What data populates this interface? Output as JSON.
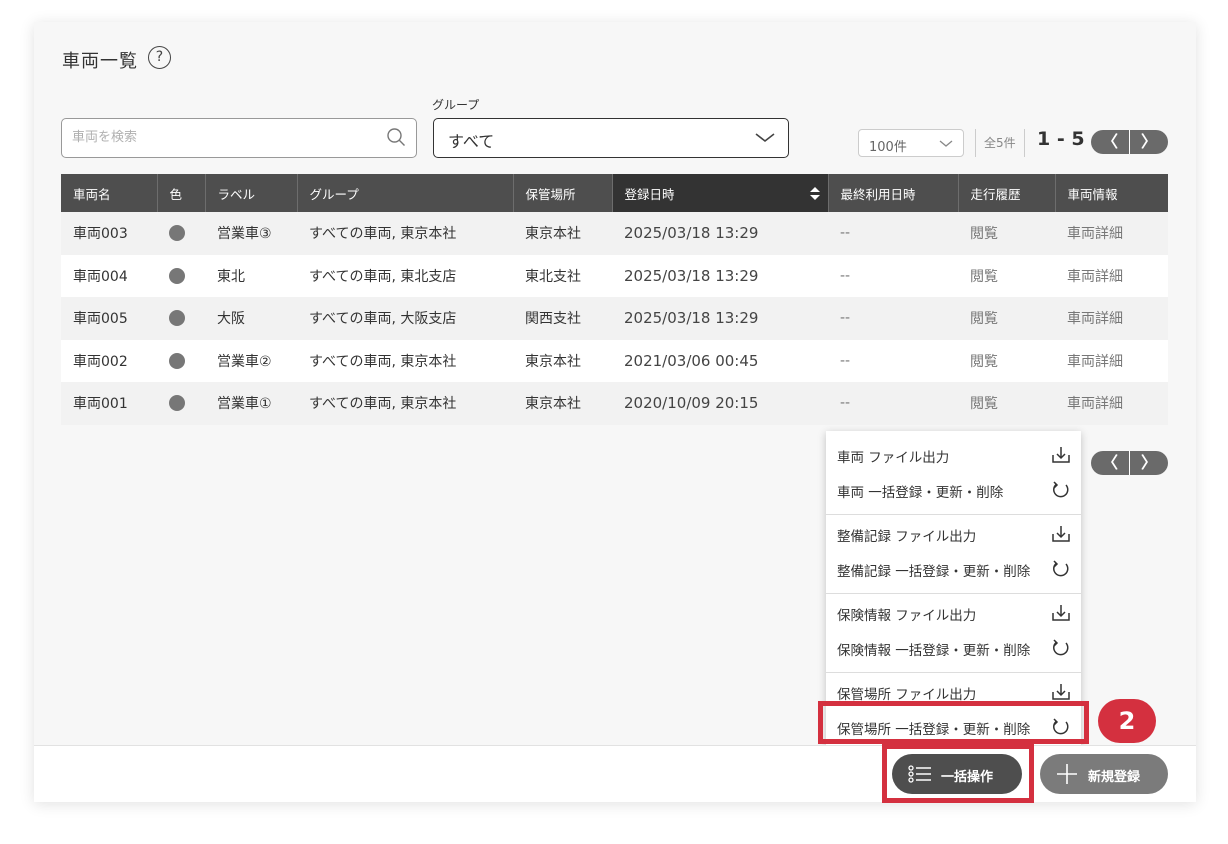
{
  "header": {
    "title": "車両一覧",
    "help_icon": "?"
  },
  "search": {
    "placeholder": "車両を検索",
    "value": ""
  },
  "group_filter": {
    "label": "グループ",
    "selected": "すべて"
  },
  "pagination": {
    "per_page": "100件",
    "total": "全5件",
    "range": "1 - 5",
    "prev": "〈",
    "next": "〉"
  },
  "table": {
    "columns": [
      "車両名",
      "色",
      "ラベル",
      "グループ",
      "保管場所",
      "登録日時",
      "最終利用日時",
      "走行履歴",
      "車両情報"
    ],
    "sorted_column": "登録日時",
    "rows": [
      {
        "name": "車両003",
        "color": "#777777",
        "label": "営業車③",
        "group": "すべての車両, 東京本社",
        "location": "東京本社",
        "registered": "2025/03/18 13:29",
        "last_used": "--",
        "history": "閲覧",
        "info": "車両詳細"
      },
      {
        "name": "車両004",
        "color": "#777777",
        "label": "東北",
        "group": "すべての車両, 東北支店",
        "location": "東北支社",
        "registered": "2025/03/18 13:29",
        "last_used": "--",
        "history": "閲覧",
        "info": "車両詳細"
      },
      {
        "name": "車両005",
        "color": "#777777",
        "label": "大阪",
        "group": "すべての車両, 大阪支店",
        "location": "関西支社",
        "registered": "2025/03/18 13:29",
        "last_used": "--",
        "history": "閲覧",
        "info": "車両詳細"
      },
      {
        "name": "車両002",
        "color": "#777777",
        "label": "営業車②",
        "group": "すべての車両, 東京本社",
        "location": "東京本社",
        "registered": "2021/03/06 00:45",
        "last_used": "--",
        "history": "閲覧",
        "info": "車両詳細"
      },
      {
        "name": "車両001",
        "color": "#777777",
        "label": "営業車①",
        "group": "すべての車両, 東京本社",
        "location": "東京本社",
        "registered": "2020/10/09 20:15",
        "last_used": "--",
        "history": "閲覧",
        "info": "車両詳細"
      }
    ]
  },
  "bulk_menu": {
    "items": [
      {
        "label": "車両 ファイル出力",
        "icon": "download-icon"
      },
      {
        "label": "車両 一括登録・更新・削除",
        "icon": "refresh-icon"
      },
      {
        "label": "整備記録 ファイル出力",
        "icon": "download-icon"
      },
      {
        "label": "整備記録 一括登録・更新・削除",
        "icon": "refresh-icon"
      },
      {
        "label": "保険情報 ファイル出力",
        "icon": "download-icon"
      },
      {
        "label": "保険情報 一括登録・更新・削除",
        "icon": "refresh-icon"
      },
      {
        "label": "保管場所 ファイル出力",
        "icon": "download-icon"
      },
      {
        "label": "保管場所 一括登録・更新・削除",
        "icon": "refresh-icon"
      }
    ]
  },
  "annotation": {
    "step": "2",
    "color": "#d4303f"
  },
  "footer": {
    "bulk_label": "一括操作",
    "new_label": "新規登録"
  }
}
